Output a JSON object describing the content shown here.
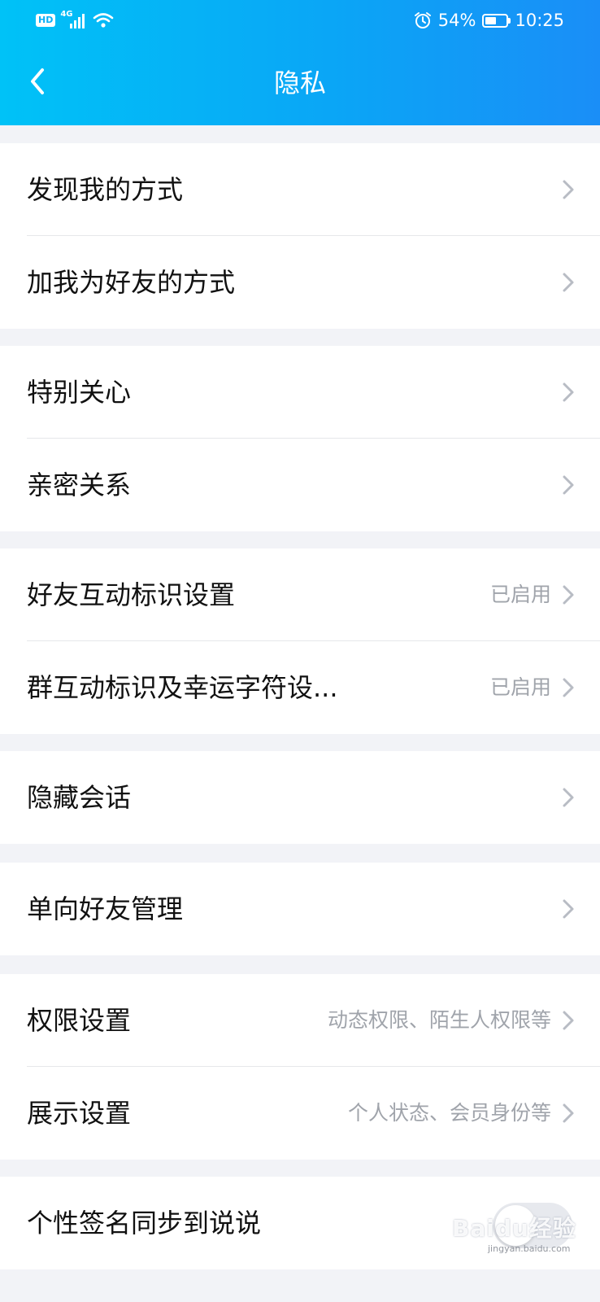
{
  "status_bar": {
    "hd": "HD",
    "network": "4G",
    "battery_percent": "54%",
    "battery_level": 0.54,
    "time": "10:25",
    "icons": [
      "hd-icon",
      "signal-icon",
      "wifi-icon",
      "alarm-icon",
      "battery-icon"
    ]
  },
  "header": {
    "title": "隐私",
    "back_icon": "chevron-left-icon"
  },
  "groups": [
    {
      "items": [
        {
          "label": "发现我的方式",
          "value": ""
        },
        {
          "label": "加我为好友的方式",
          "value": ""
        }
      ]
    },
    {
      "items": [
        {
          "label": "特别关心",
          "value": ""
        },
        {
          "label": "亲密关系",
          "value": ""
        }
      ]
    },
    {
      "items": [
        {
          "label": "好友互动标识设置",
          "value": "已启用"
        },
        {
          "label": "群互动标识及幸运字符设...",
          "value": "已启用"
        }
      ]
    },
    {
      "items": [
        {
          "label": "隐藏会话",
          "value": ""
        }
      ]
    },
    {
      "items": [
        {
          "label": "单向好友管理",
          "value": ""
        }
      ]
    },
    {
      "items": [
        {
          "label": "权限设置",
          "value": "动态权限、陌生人权限等"
        },
        {
          "label": "展示设置",
          "value": "个人状态、会员身份等"
        }
      ]
    },
    {
      "items": [
        {
          "label": "个性签名同步到说说",
          "toggle_on": false
        }
      ]
    }
  ],
  "watermark": {
    "text": "Baidu经验",
    "sub": "jingyan.baidu.com"
  },
  "colors": {
    "header_gradient_start": "#00c2f7",
    "header_gradient_end": "#1a8ef7",
    "background": "#f2f3f7",
    "secondary_text": "#a0a4ab"
  }
}
